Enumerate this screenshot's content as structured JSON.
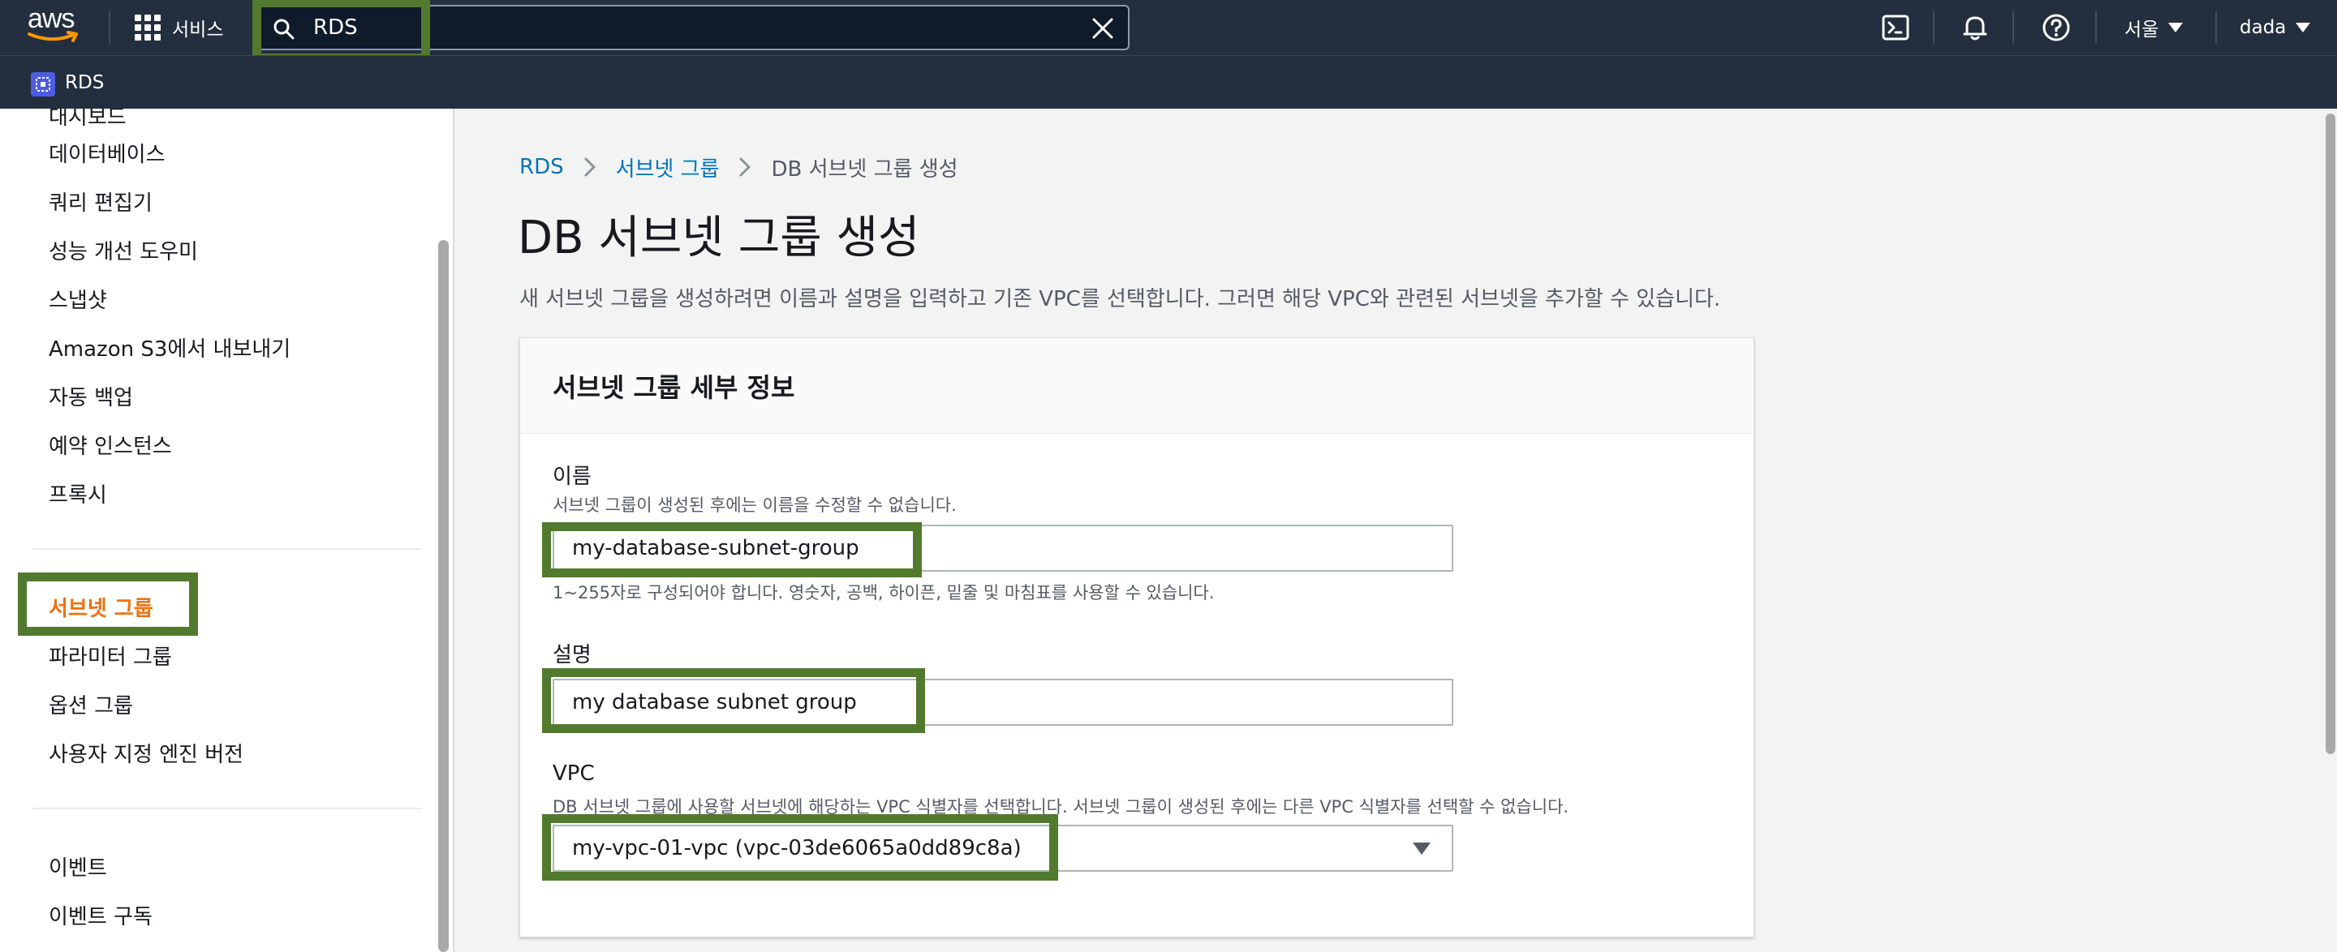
{
  "topnav": {
    "logo_text": "aws",
    "services_label": "서비스",
    "search": {
      "value": "RDS"
    },
    "region": "서울",
    "user": "dada",
    "icons": [
      "cloudshell-icon",
      "bell-icon",
      "help-icon"
    ]
  },
  "servicebar": {
    "service_name": "RDS"
  },
  "sidebar": {
    "items_top": [
      "데이터베이스",
      "쿼리 편집기",
      "성능 개선 도우미",
      "스냅샷",
      "Amazon S3에서 내보내기",
      "자동 백업",
      "예약 인스턴스",
      "프록시"
    ],
    "items_mid": [
      "서브넷 그룹",
      "파라미터 그룹",
      "옵션 그룹",
      "사용자 지정 엔진 버전"
    ],
    "items_bottom": [
      "이벤트",
      "이벤트 구독"
    ],
    "active_item": "서브넷 그룹"
  },
  "breadcrumb": [
    "RDS",
    "서브넷 그룹",
    "DB 서브넷 그룹 생성"
  ],
  "page": {
    "title": "DB 서브넷 그룹 생성",
    "description": "새 서브넷 그룹을 생성하려면 이름과 설명을 입력하고 기존 VPC를 선택합니다. 그러면 해당 VPC와 관련된 서브넷을 추가할 수 있습니다."
  },
  "panel": {
    "title": "서브넷 그룹 세부 정보",
    "name": {
      "label": "이름",
      "help": "서브넷 그룹이 생성된 후에는 이름을 수정할 수 없습니다.",
      "value": "my-database-subnet-group",
      "constraint": "1~255자로 구성되어야 합니다. 영숫자, 공백, 하이픈, 밑줄 및 마침표를 사용할 수 있습니다."
    },
    "description": {
      "label": "설명",
      "value": "my database subnet group"
    },
    "vpc": {
      "label": "VPC",
      "help": "DB 서브넷 그룹에 사용할 서브넷에 해당하는 VPC 식별자를 선택합니다. 서브넷 그룹이 생성된 후에는 다른 VPC 식별자를 선택할 수 없습니다.",
      "value": "my-vpc-01-vpc (vpc-03de6065a0dd89c8a)"
    }
  },
  "colors": {
    "nav_bg": "#232f3e",
    "link": "#0073bb",
    "active": "#ec7211",
    "highlight": "#527a2e"
  }
}
